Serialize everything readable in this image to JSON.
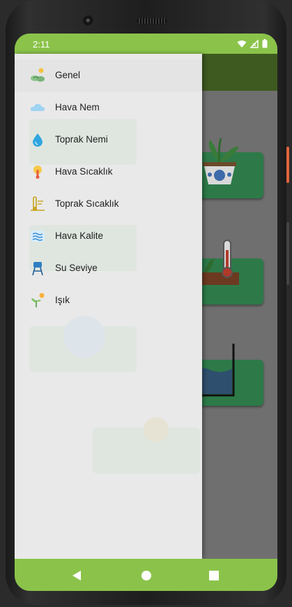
{
  "status_bar": {
    "time": "2:11"
  },
  "drawer": {
    "items": [
      {
        "label": "Genel",
        "icon": "plants-icon",
        "selected": true
      },
      {
        "label": "Hava Nem",
        "icon": "cloud-icon"
      },
      {
        "label": "Toprak Nemi",
        "icon": "water-drop-icon"
      },
      {
        "label": "Hava Sıcaklık",
        "icon": "sun-thermometer-icon"
      },
      {
        "label": "Toprak Sıcaklık",
        "icon": "soil-thermometer-icon"
      },
      {
        "label": "Hava Kalite",
        "icon": "air-waves-icon"
      },
      {
        "label": "Su Seviye",
        "icon": "water-tower-icon"
      },
      {
        "label": "Işık",
        "icon": "sunlight-plant-icon"
      }
    ]
  },
  "colors": {
    "primary": "#8bc34a",
    "app_bar_dimmed": "#3e5a20",
    "card": "#2d7a48",
    "drawer_background": "#e9e9e9"
  },
  "navigation": {
    "back": "back-icon",
    "home": "home-icon",
    "recents": "recents-icon"
  }
}
